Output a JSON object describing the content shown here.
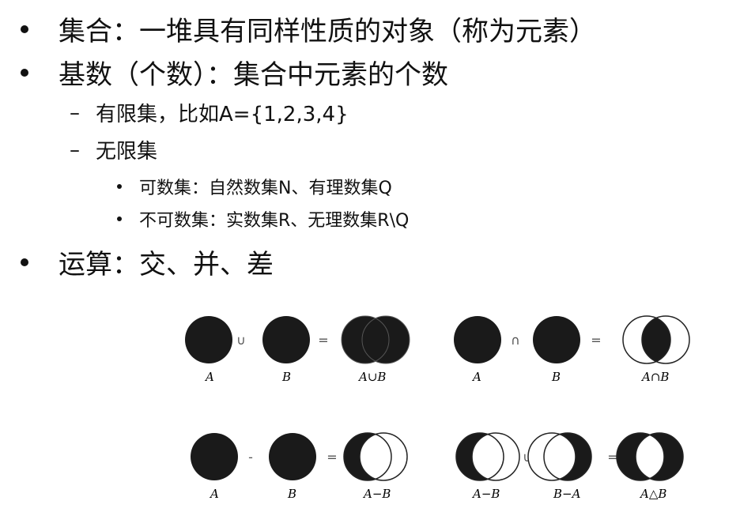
{
  "bullets": {
    "b1": "集合：一堆具有同样性质的对象（称为元素）",
    "b2": "基数（个数）：集合中元素的个数",
    "b2_sub1": "有限集，比如A={1,2,3,4}",
    "b2_sub2": "无限集",
    "b2_sub2_1": "可数集：自然数集N、有理数集Q",
    "b2_sub2_2": "不可数集：实数集R、无理数集R\\Q",
    "b3": "运算：交、并、差"
  },
  "dash_glyph": "–",
  "figure": {
    "union": {
      "op1": "∪",
      "eq": "=",
      "labels": [
        "A",
        "B",
        "A∪B"
      ]
    },
    "intersection": {
      "op1": "∩",
      "eq": "=",
      "labels": [
        "A",
        "B",
        "A∩B"
      ]
    },
    "difference": {
      "op1": "-",
      "eq": "=",
      "labels": [
        "A",
        "B",
        "A−B"
      ]
    },
    "symmetric_difference": {
      "op1": "∪",
      "eq": "=",
      "labels": [
        "A−B",
        "B−A",
        "A△B"
      ]
    }
  },
  "colors": {
    "fill": "#1a1a1a",
    "stroke": "#222222",
    "text": "#111111"
  }
}
